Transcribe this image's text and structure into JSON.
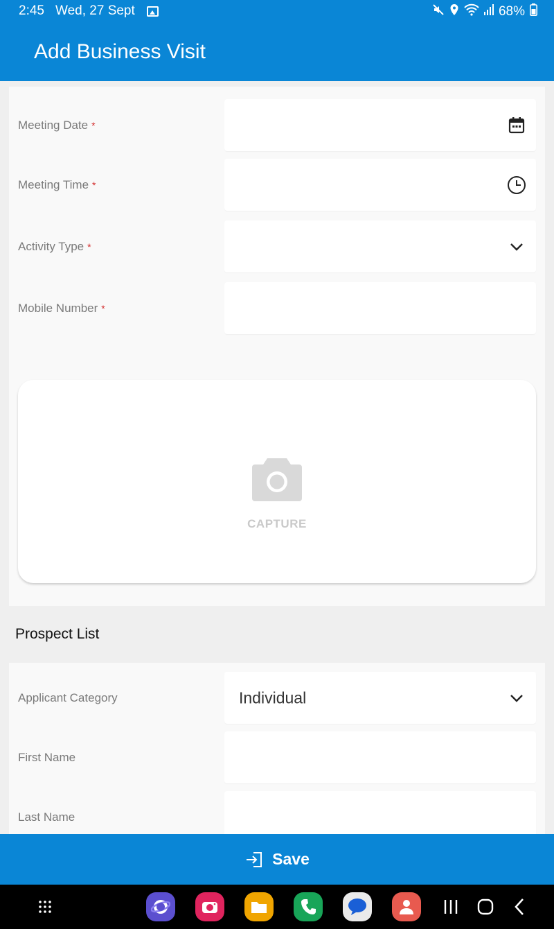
{
  "status_bar": {
    "time": "2:45",
    "date": "Wed, 27 Sept",
    "battery": "68%"
  },
  "app_bar": {
    "title": "Add Business Visit"
  },
  "form": {
    "meeting_date": {
      "label": "Meeting Date",
      "required": "*",
      "value": "",
      "icon": "calendar-icon"
    },
    "meeting_time": {
      "label": "Meeting Time",
      "required": "*",
      "value": "",
      "icon": "clock-icon"
    },
    "activity_type": {
      "label": "Activity Type",
      "required": "*",
      "value": "",
      "icon": "chevron-down-icon"
    },
    "mobile_number": {
      "label": "Mobile Number",
      "required": "*",
      "value": ""
    },
    "capture": {
      "label": "CAPTURE",
      "icon": "camera-icon"
    }
  },
  "prospect": {
    "section_title": "Prospect List",
    "applicant_category": {
      "label": "Applicant Category",
      "value": "Individual",
      "icon": "chevron-down-icon"
    },
    "first_name": {
      "label": "First Name",
      "value": ""
    },
    "last_name": {
      "label": "Last Name",
      "value": ""
    }
  },
  "footer": {
    "save_label": "Save",
    "save_icon": "login-arrow-icon"
  },
  "nav": {
    "apps": [
      "internet-app-icon",
      "camera-app-icon",
      "files-app-icon",
      "phone-app-icon",
      "messages-app-icon",
      "contacts-app-icon"
    ],
    "colors": {
      "primary": "#0a86d6",
      "required": "#d32f2f"
    }
  }
}
